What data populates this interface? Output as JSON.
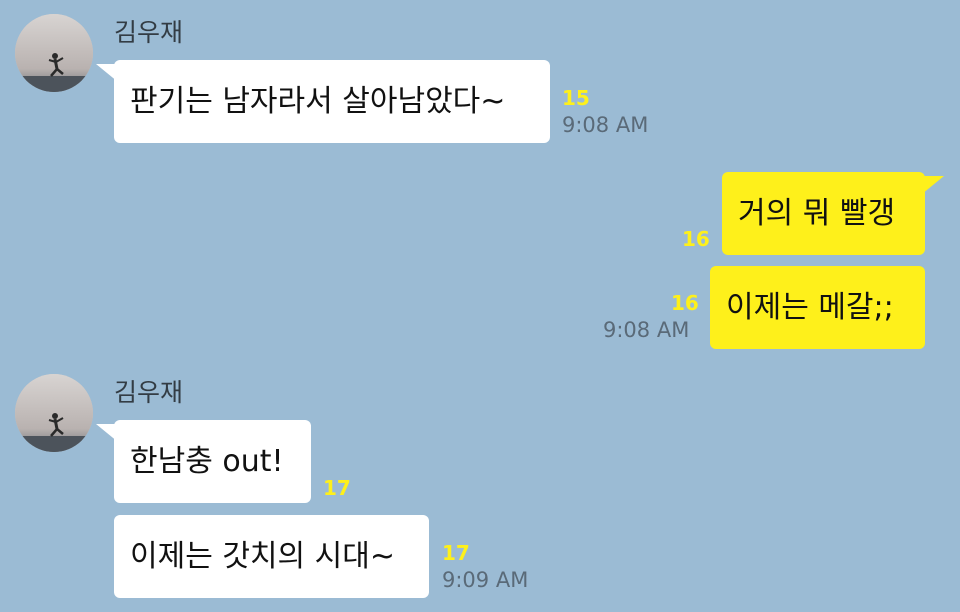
{
  "groups": [
    {
      "sender": "김우재",
      "avatar_icon": "profile-photo-person-jumping",
      "messages": [
        {
          "text": "판기는 남자라서 살아남았다~",
          "unread": "15",
          "time": "9:08 AM"
        }
      ]
    },
    {
      "sender": "me",
      "messages": [
        {
          "text": "거의 뭐 빨갱",
          "unread": "16",
          "time": ""
        },
        {
          "text": "이제는 메갈;;",
          "unread": "16",
          "time": "9:08 AM"
        }
      ]
    },
    {
      "sender": "김우재",
      "avatar_icon": "profile-photo-person-jumping",
      "messages": [
        {
          "text": "한남충 out!",
          "unread": "17",
          "time": ""
        },
        {
          "text": "이제는 갓치의 시대~",
          "unread": "17",
          "time": "9:09 AM"
        }
      ]
    }
  ],
  "colors": {
    "background": "#9bbbd4",
    "incoming_bubble": "#ffffff",
    "outgoing_bubble": "#fef01b",
    "unread_count": "#fef01b",
    "timestamp": "#5a6a78"
  }
}
